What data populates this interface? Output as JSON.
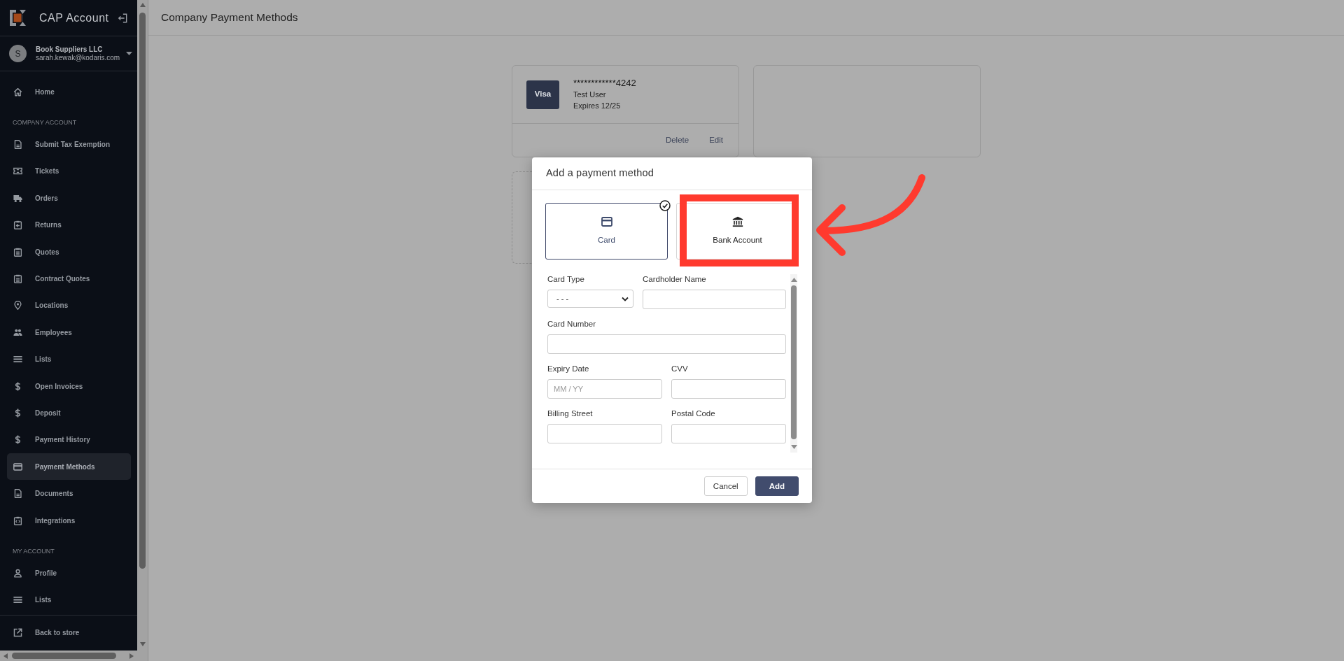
{
  "sidebar": {
    "brand": "CAP Account",
    "account": {
      "avatar": "S",
      "company": "Book Suppliers LLC",
      "email": "sarah.kewak@kodaris.com"
    },
    "groups": [
      {
        "items": [
          {
            "label": "Home",
            "selected": false
          }
        ]
      },
      {
        "heading": "COMPANY ACCOUNT",
        "items": [
          {
            "label": "Submit Tax Exemption",
            "selected": false
          },
          {
            "label": "Tickets",
            "selected": false
          },
          {
            "label": "Orders",
            "selected": false
          },
          {
            "label": "Returns",
            "selected": false
          },
          {
            "label": "Quotes",
            "selected": false
          },
          {
            "label": "Contract Quotes",
            "selected": false
          },
          {
            "label": "Locations",
            "selected": false
          },
          {
            "label": "Employees",
            "selected": false
          },
          {
            "label": "Lists",
            "selected": false
          },
          {
            "label": "Open Invoices",
            "selected": false
          },
          {
            "label": "Deposit",
            "selected": false
          },
          {
            "label": "Payment History",
            "selected": false
          },
          {
            "label": "Payment Methods",
            "selected": true
          },
          {
            "label": "Documents",
            "selected": false
          },
          {
            "label": "Integrations",
            "selected": false
          }
        ]
      },
      {
        "heading": "MY ACCOUNT",
        "items": [
          {
            "label": "Profile",
            "selected": false
          },
          {
            "label": "Lists",
            "selected": false
          }
        ]
      }
    ],
    "footer_link": "Back to store"
  },
  "page": {
    "title": "Company Payment Methods"
  },
  "payment_methods": [
    {
      "kind": "saved",
      "brand": "Visa",
      "number": "************4242",
      "holder": "Test User",
      "expiry": "Expires 12/25",
      "actions": [
        "Delete",
        "Edit"
      ]
    },
    {
      "kind": "blank"
    },
    {
      "kind": "add"
    }
  ],
  "modal": {
    "title": "Add a payment method",
    "options": [
      {
        "label": "Card",
        "selected": true,
        "highlighted": false
      },
      {
        "label": "Bank Account",
        "selected": false,
        "highlighted": true
      }
    ],
    "field_rows": [
      [
        {
          "label": "Card Type",
          "kind": "select",
          "value": "- - -"
        },
        {
          "label": "Cardholder Name",
          "kind": "text"
        }
      ],
      [
        {
          "label": "Card Number",
          "kind": "text"
        }
      ],
      [
        {
          "label": "Expiry Date",
          "kind": "text",
          "placeholder": "MM / YY"
        },
        {
          "label": "CVV",
          "kind": "text"
        }
      ],
      [
        {
          "label": "Billing Street",
          "kind": "text"
        },
        {
          "label": "Postal Code",
          "kind": "text"
        }
      ]
    ],
    "buttons": [
      {
        "label": "Cancel",
        "kind": "secondary"
      },
      {
        "label": "Add",
        "kind": "primary"
      }
    ]
  },
  "annotations": [
    {
      "kind": "curved-arrow"
    }
  ]
}
